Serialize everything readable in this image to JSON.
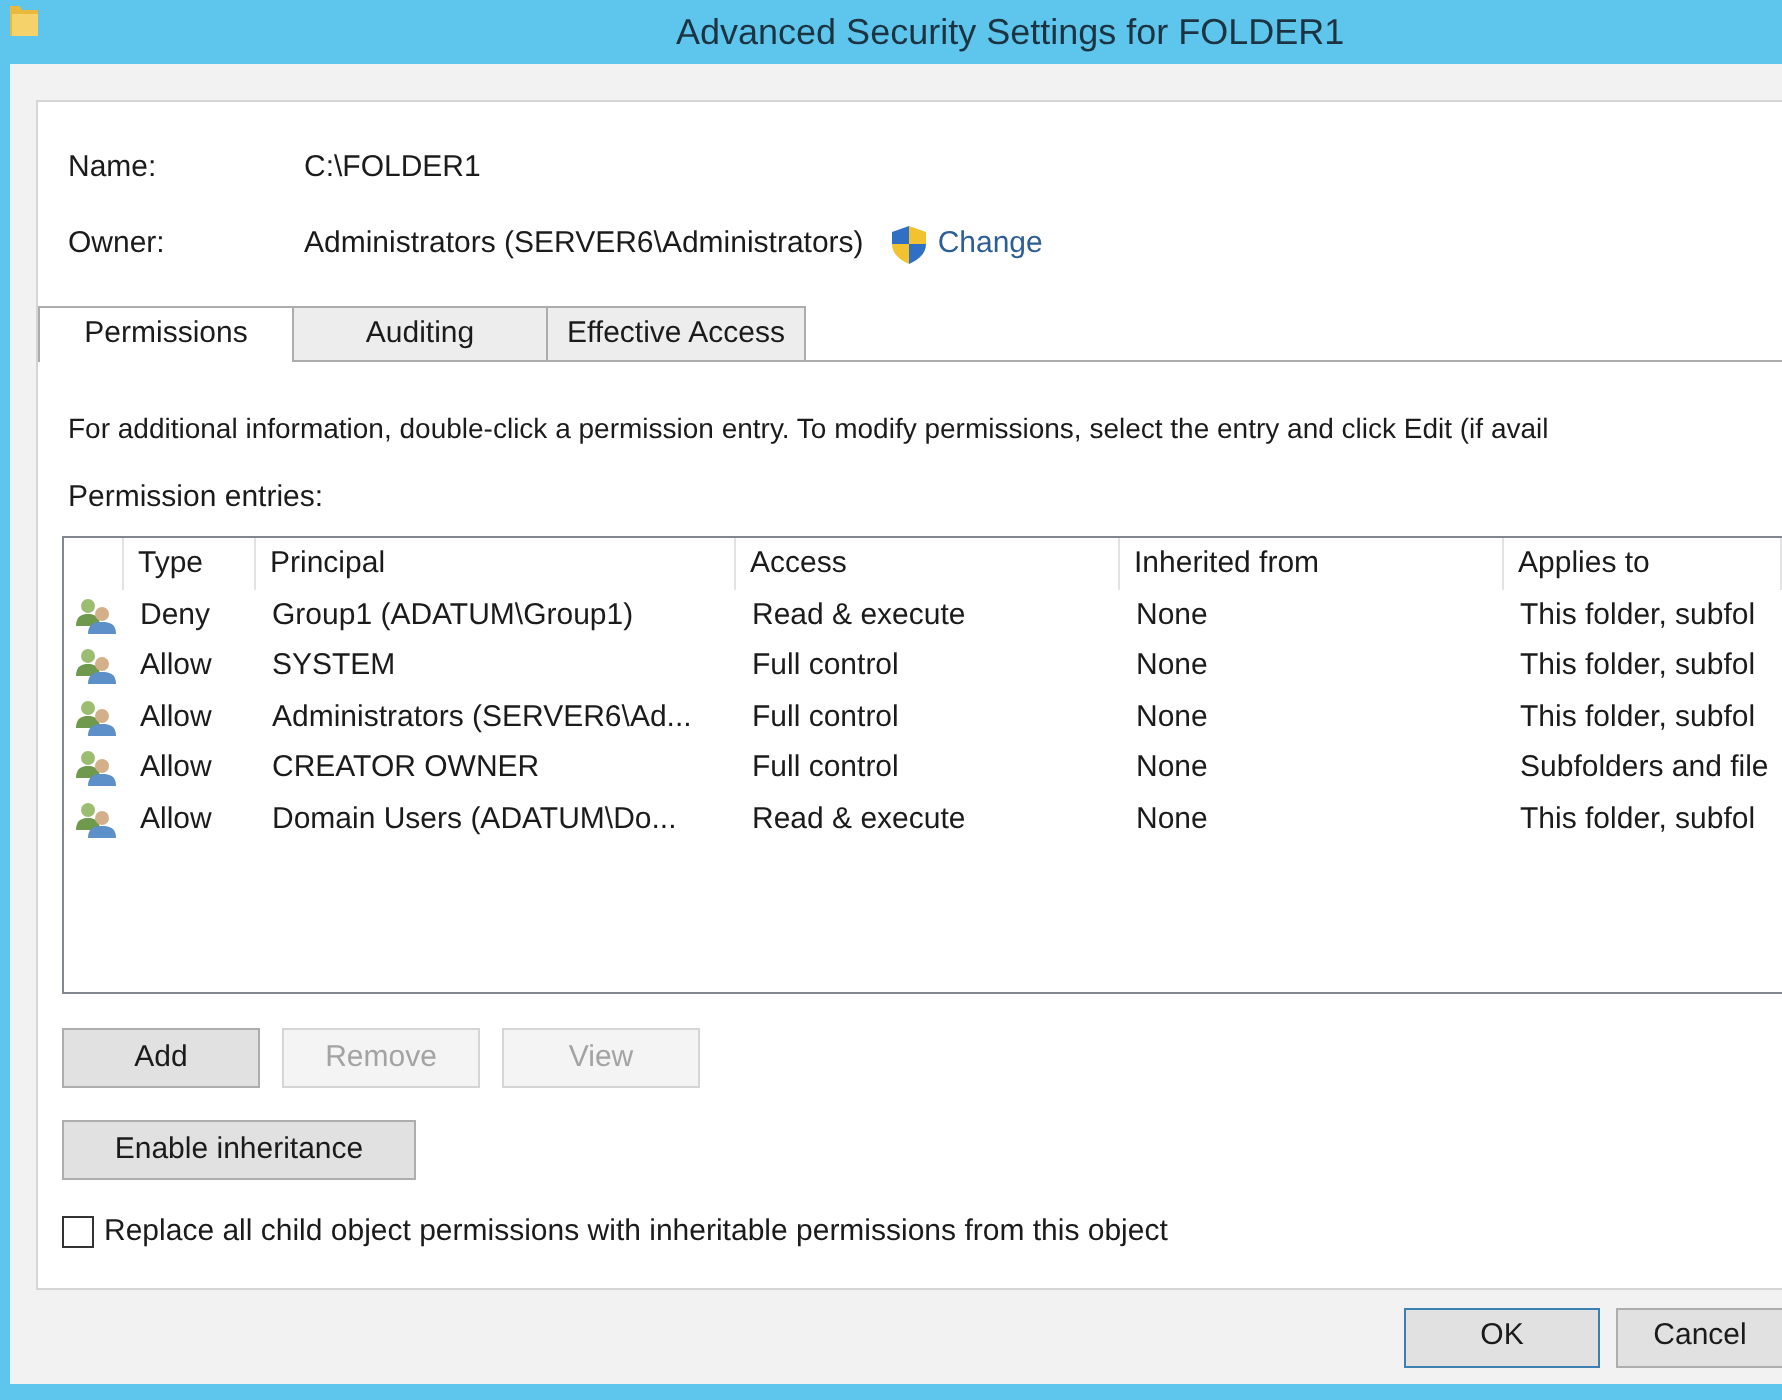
{
  "window": {
    "title": "Advanced Security Settings for FOLDER1"
  },
  "name_field": {
    "label": "Name:",
    "value": "C:\\FOLDER1"
  },
  "owner_field": {
    "label": "Owner:",
    "value": "Administrators (SERVER6\\Administrators)",
    "link": "Change"
  },
  "tabs": [
    {
      "label": "Permissions",
      "selected": true
    },
    {
      "label": "Auditing",
      "selected": false
    },
    {
      "label": "Effective Access",
      "selected": false
    }
  ],
  "info_text": "For additional information, double-click a permission entry. To modify permissions, select the entry and click Edit (if avail",
  "entries_label": "Permission entries:",
  "table": {
    "columns": [
      "Type",
      "Principal",
      "Access",
      "Inherited from",
      "Applies to"
    ],
    "rows": [
      {
        "type": "Deny",
        "principal": "Group1 (ADATUM\\Group1)",
        "access": "Read & execute",
        "inherited_from": "None",
        "applies_to": "This folder, subfol",
        "selected": false
      },
      {
        "type": "Allow",
        "principal": "SYSTEM",
        "access": "Full control",
        "inherited_from": "None",
        "applies_to": "This folder, subfol",
        "selected": false
      },
      {
        "type": "Allow",
        "principal": "Administrators (SERVER6\\Ad...",
        "access": "Full control",
        "inherited_from": "None",
        "applies_to": "This folder, subfol",
        "selected": false
      },
      {
        "type": "Allow",
        "principal": "CREATOR OWNER",
        "access": "Full control",
        "inherited_from": "None",
        "applies_to": "Subfolders and file",
        "selected": false
      },
      {
        "type": "Allow",
        "principal": "Domain Users (ADATUM\\Do...",
        "access": "Read & execute",
        "inherited_from": "None",
        "applies_to": "This folder, subfol",
        "selected": false
      }
    ]
  },
  "entry_buttons": [
    {
      "label": "Add",
      "disabled": false
    },
    {
      "label": "Remove",
      "disabled": true
    },
    {
      "label": "View",
      "disabled": true
    }
  ],
  "inheritance_button": {
    "label": "Enable inheritance",
    "disabled": false
  },
  "replace_checkbox": {
    "label": "Replace all child object permissions with inheritable permissions from this object",
    "checked": false
  },
  "dialog_buttons": [
    {
      "label": "OK",
      "default": true
    },
    {
      "label": "Cancel",
      "default": false
    }
  ]
}
